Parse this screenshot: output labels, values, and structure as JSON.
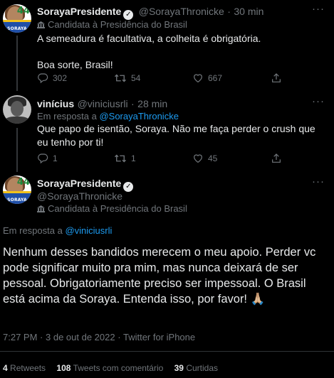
{
  "tweet1": {
    "author_name": "SorayaPresidente",
    "handle": "@SorayaThronicke",
    "time": "30 min",
    "label": "Candidata à Presidência do Brasil",
    "avatar_text": "SORAYA",
    "avatar_number": "44",
    "text_line1": "A semeadura é facultativa, a colheita é obrigatória.",
    "text_line2": "Boa sorte, Brasil!",
    "replies": "302",
    "retweets": "54",
    "likes": "667"
  },
  "tweet2": {
    "author_name": "vinícius",
    "handle": "@viniciusrli",
    "time": "28 min",
    "reply_prefix": "Em resposta a",
    "reply_to": "@SorayaThronicke",
    "text": "Que papo de isentão, Soraya. Não me faça perder o crush que eu tenho por ti!",
    "replies": "1",
    "retweets": "1",
    "likes": "45"
  },
  "main_tweet": {
    "author_name": "SorayaPresidente",
    "handle": "@SorayaThronicke",
    "label": "Candidata à Presidência do Brasil",
    "avatar_text": "SORAYA",
    "avatar_number": "44",
    "reply_prefix": "Em resposta a",
    "reply_to": "@viniciusrli",
    "text": "Nenhum desses bandidos merecem o meu apoio. Perder vc pode significar muito pra mim, mas nunca deixará de ser pessoal. Obrigatoriamente preciso ser impessoal. O Brasil está acima da Soraya. Entenda isso, por favor! 🙏🏼",
    "time": "7:27 PM",
    "separator": "·",
    "date": "3 de out de 2022",
    "source": "Twitter for iPhone"
  },
  "stats": {
    "retweets_count": "4",
    "retweets_label": "Retweets",
    "quotes_count": "108",
    "quotes_label": "Tweets com comentário",
    "likes_count": "39",
    "likes_label": "Curtidas"
  },
  "icons": {
    "more": "more-icon",
    "reply": "reply-icon",
    "retweet": "retweet-icon",
    "like": "heart-icon",
    "verified": "verified-badge-icon",
    "label": "government-building-icon",
    "pray": "folded-hands-emoji"
  },
  "colors": {
    "background": "#000000",
    "text": "#e7e9ea",
    "muted": "#71767b",
    "link": "#1d9bf0",
    "divider": "#2f3336"
  }
}
